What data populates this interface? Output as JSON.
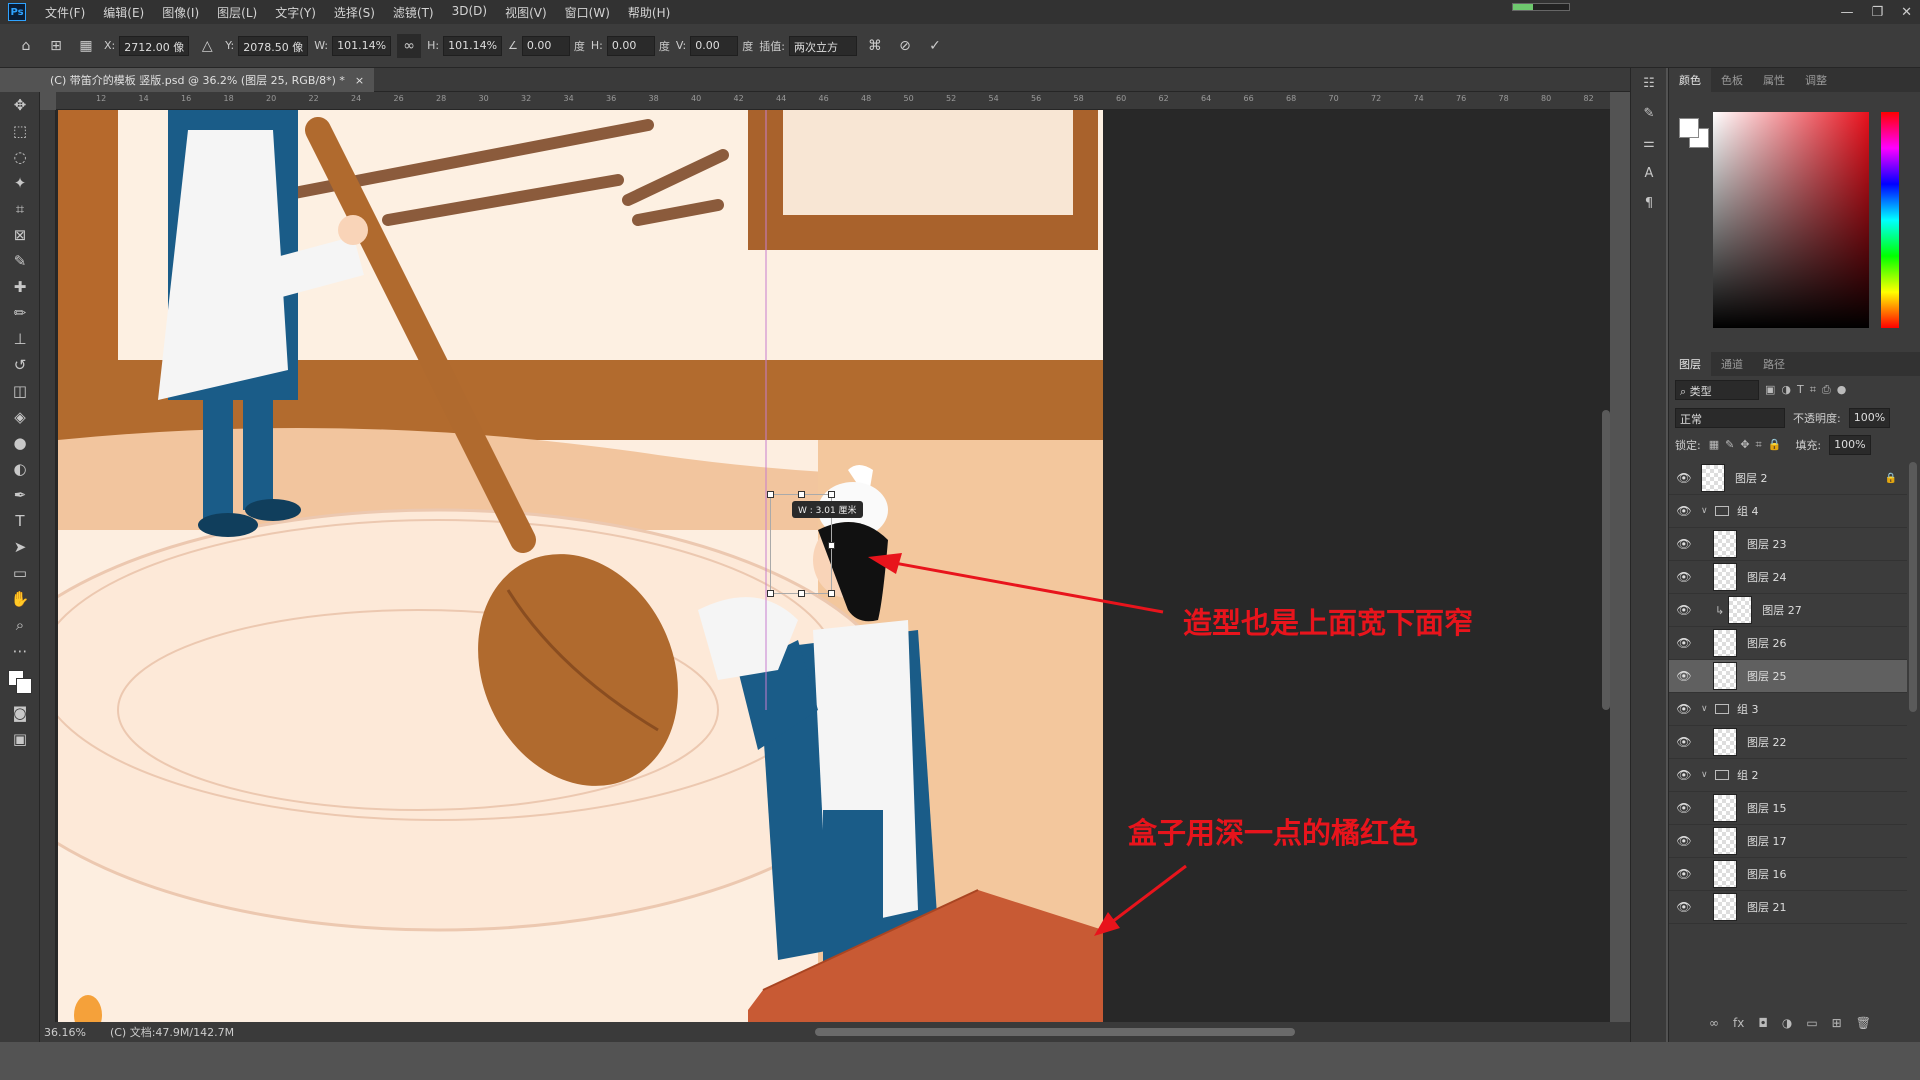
{
  "app": {
    "menu": [
      "文件(F)",
      "编辑(E)",
      "图像(I)",
      "图层(L)",
      "文字(Y)",
      "选择(S)",
      "滤镜(T)",
      "3D(D)",
      "视图(V)",
      "窗口(W)",
      "帮助(H)"
    ],
    "progress_fraction": 0.35,
    "window_controls": [
      "—",
      "❐",
      "✕"
    ]
  },
  "options_bar": {
    "x_label": "X:",
    "x_value": "2712.00 像",
    "y_label": "Y:",
    "y_value": "2078.50 像",
    "w_label": "W:",
    "w_value": "101.14%",
    "h_label": "H:",
    "h_value": "101.14%",
    "angle_value": "0.00",
    "angle_unit": "度",
    "hskew_label": "H:",
    "hskew_value": "0.00",
    "hskew_unit": "度",
    "vskew_label": "V:",
    "vskew_value": "0.00",
    "vskew_unit": "度",
    "interp_label": "插值:",
    "interp_value": "两次立方"
  },
  "document": {
    "tab_title": "(C) 带笛介的模板 竖版.psd @ 36.2% (图层 25, RGB/8*) *",
    "tab_close": "×",
    "zoom": "36.16%",
    "doc_info": "(C) 文档:47.9M/142.7M",
    "ruler_ticks": [
      "12",
      "14",
      "16",
      "18",
      "20",
      "22",
      "24",
      "26",
      "28",
      "30",
      "32",
      "34",
      "36",
      "38",
      "40",
      "42",
      "44",
      "46",
      "48",
      "50",
      "52",
      "54",
      "56",
      "58",
      "60",
      "62",
      "64",
      "66",
      "68",
      "70",
      "72",
      "74",
      "76",
      "78",
      "80",
      "82"
    ],
    "transform_tooltip": "W : 3.01 厘米"
  },
  "annotations": [
    {
      "text": "造型也是上面宽下面窄"
    },
    {
      "text": "盒子用深一点的橘红色"
    }
  ],
  "panels": {
    "color_tabs": [
      "颜色",
      "色板",
      "属性",
      "调整"
    ],
    "layer_tabs": [
      "图层",
      "通道",
      "路径"
    ],
    "filter_kind": "类型",
    "blend_mode": "正常",
    "opacity_label": "不透明度:",
    "opacity_value": "100%",
    "lock_label": "锁定:",
    "fill_label": "填充:",
    "fill_value": "100%",
    "layers": [
      {
        "name": "图层 2",
        "type": "layer",
        "locked": true,
        "indent": 0
      },
      {
        "name": "组 4",
        "type": "group",
        "indent": 0
      },
      {
        "name": "图层 23",
        "type": "layer",
        "indent": 1
      },
      {
        "name": "图层 24",
        "type": "layer",
        "indent": 1
      },
      {
        "name": "图层 27",
        "type": "layer",
        "indent": 1,
        "clipped": true
      },
      {
        "name": "图层 26",
        "type": "layer",
        "indent": 1
      },
      {
        "name": "图层 25",
        "type": "layer",
        "indent": 1,
        "selected": true
      },
      {
        "name": "组 3",
        "type": "group",
        "indent": 0
      },
      {
        "name": "图层 22",
        "type": "layer",
        "indent": 1
      },
      {
        "name": "组 2",
        "type": "group",
        "indent": 0
      },
      {
        "name": "图层 15",
        "type": "layer",
        "indent": 1
      },
      {
        "name": "图层 17",
        "type": "layer",
        "indent": 1
      },
      {
        "name": "图层 16",
        "type": "layer",
        "indent": 1
      },
      {
        "name": "图层 21",
        "type": "layer",
        "indent": 1
      }
    ]
  },
  "colors": {
    "annotation_red": "#e8141c",
    "box_orange_red": "#c85a34",
    "apron_blue": "#1a5c88",
    "spoon_brown": "#b46a2c"
  }
}
